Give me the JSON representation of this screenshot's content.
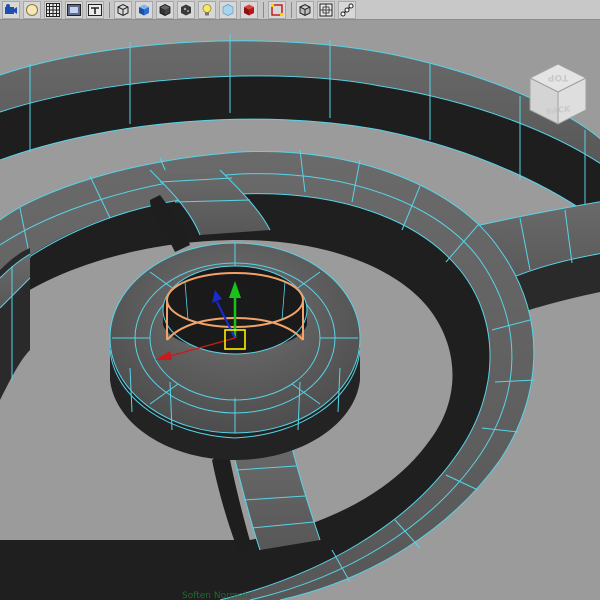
{
  "toolbar": {
    "buttons": [
      {
        "id": "select-camera",
        "icon": "camera-select-icon"
      },
      {
        "id": "lock-camera",
        "icon": "camera-lock-icon"
      },
      {
        "id": "grid",
        "icon": "grid-icon"
      },
      {
        "id": "film-gate",
        "icon": "film-gate-icon"
      },
      {
        "id": "resolution-gate",
        "icon": "resolution-gate-icon"
      },
      {
        "id": "wireframe",
        "icon": "wireframe-cube-icon"
      },
      {
        "id": "smooth-shade",
        "icon": "smooth-shade-cube-icon"
      },
      {
        "id": "wireframe-on-shaded",
        "icon": "wire-on-shaded-icon"
      },
      {
        "id": "textured",
        "icon": "textured-icon"
      },
      {
        "id": "lights",
        "icon": "light-bulb-icon"
      },
      {
        "id": "xray",
        "icon": "xray-cube-icon"
      },
      {
        "id": "shadows",
        "icon": "shadow-cube-icon"
      },
      {
        "id": "isolate-select",
        "icon": "isolate-select-icon"
      },
      {
        "id": "backface",
        "icon": "backface-cube-icon"
      },
      {
        "id": "xray-joints",
        "icon": "xray-joints-icon"
      },
      {
        "id": "joints",
        "icon": "joints-icon"
      }
    ]
  },
  "viewcube": {
    "top_label": "TOP",
    "back_label": "BACK"
  },
  "status": {
    "text": "Soften Normals"
  },
  "colors": {
    "viewport_bg": "#9b9b9b",
    "wire": "#57d4e8",
    "selected_edges": "#f2a36a",
    "manip_y": "#19c21a",
    "manip_z": "#1a2acc",
    "manip_x": "#cc1a1a",
    "pivot": "#ffee00"
  }
}
